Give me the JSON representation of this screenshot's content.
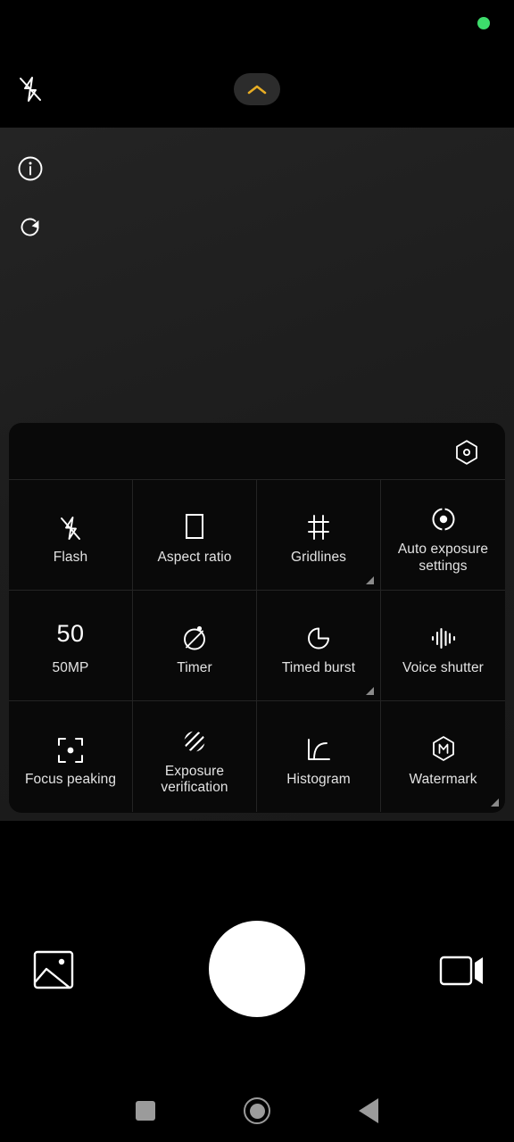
{
  "status": {
    "privacy_indicator": "green-dot",
    "privacy_color": "#3ddc6b"
  },
  "topbar": {
    "flash_icon": "flash-off-icon",
    "flash_state": "off",
    "expand_icon": "chevron-up-icon",
    "expand_color": "#e8ad24"
  },
  "viewfinder": {
    "left_tools": [
      {
        "name": "info-icon",
        "label": "Info"
      },
      {
        "name": "refresh-icon",
        "label": "Reset"
      }
    ]
  },
  "settings_panel": {
    "header": {
      "gear_icon": "hexagon-settings-icon"
    },
    "items": [
      {
        "icon": "flash-off-icon",
        "label": "Flash",
        "value": "",
        "expandable": false
      },
      {
        "icon": "aspect-ratio-icon",
        "label": "Aspect ratio",
        "value": "",
        "expandable": false
      },
      {
        "icon": "gridlines-icon",
        "label": "Gridlines",
        "value": "",
        "expandable": true
      },
      {
        "icon": "auto-exposure-icon",
        "label": "Auto exposure settings",
        "value": "",
        "expandable": false
      },
      {
        "icon": "megapixel-text",
        "label": "50MP",
        "value": "50",
        "expandable": false
      },
      {
        "icon": "timer-off-icon",
        "label": "Timer",
        "value": "",
        "expandable": false
      },
      {
        "icon": "timed-burst-icon",
        "label": "Timed burst",
        "value": "",
        "expandable": true
      },
      {
        "icon": "voice-shutter-icon",
        "label": "Voice shutter",
        "value": "",
        "expandable": false
      },
      {
        "icon": "focus-peaking-icon",
        "label": "Focus peaking",
        "value": "",
        "expandable": false
      },
      {
        "icon": "exposure-verify-icon",
        "label": "Exposure verification",
        "value": "",
        "expandable": false
      },
      {
        "icon": "histogram-icon",
        "label": "Histogram",
        "value": "",
        "expandable": false
      },
      {
        "icon": "watermark-icon",
        "label": "Watermark",
        "value": "",
        "expandable": true
      }
    ]
  },
  "bottombar": {
    "gallery_icon": "gallery-icon",
    "shutter_icon": "shutter-button",
    "video_icon": "video-camera-icon"
  },
  "navbar": {
    "recents_icon": "recents-square-icon",
    "home_icon": "home-circle-icon",
    "back_icon": "back-triangle-icon"
  }
}
